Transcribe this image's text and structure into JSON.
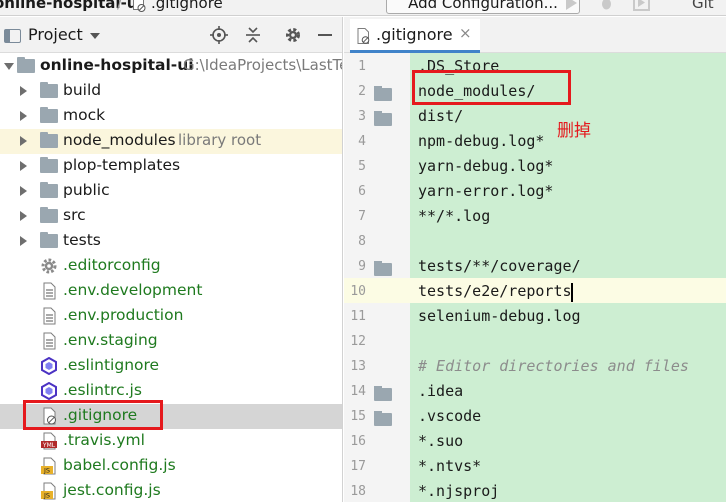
{
  "navbar": {
    "project_name": "online-hospital-ui",
    "separator": "/",
    "current_file": ".gitignore",
    "add_configuration": "Add Configuration...",
    "vcs_label": "Git"
  },
  "project_panel": {
    "title": "Project",
    "root": {
      "name": "online-hospital-ui",
      "path": "G:\\IdeaProjects\\LastTe"
    },
    "items": [
      {
        "label": "build",
        "kind": "folder"
      },
      {
        "label": "mock",
        "kind": "folder"
      },
      {
        "label": "node_modules",
        "kind": "folder",
        "hint": "library root"
      },
      {
        "label": "plop-templates",
        "kind": "folder"
      },
      {
        "label": "public",
        "kind": "folder"
      },
      {
        "label": "src",
        "kind": "folder"
      },
      {
        "label": "tests",
        "kind": "folder"
      },
      {
        "label": ".editorconfig",
        "kind": "config-file"
      },
      {
        "label": ".env.development",
        "kind": "text-file"
      },
      {
        "label": ".env.production",
        "kind": "text-file"
      },
      {
        "label": ".env.staging",
        "kind": "text-file"
      },
      {
        "label": ".eslintignore",
        "kind": "eslint-file"
      },
      {
        "label": ".eslintrc.js",
        "kind": "eslint-file"
      },
      {
        "label": ".gitignore",
        "kind": "gitignore-file",
        "selected": true
      },
      {
        "label": ".travis.yml",
        "kind": "yml-file"
      },
      {
        "label": "babel.config.js",
        "kind": "js-file"
      },
      {
        "label": "jest.config.js",
        "kind": "js-file"
      }
    ]
  },
  "editor": {
    "tab_label": ".gitignore",
    "tab_close": "×",
    "lines": [
      {
        "n": "1",
        "text": ".DS_Store"
      },
      {
        "n": "2",
        "text": "node_modules/"
      },
      {
        "n": "3",
        "text": "dist/"
      },
      {
        "n": "4",
        "text": "npm-debug.log*"
      },
      {
        "n": "5",
        "text": "yarn-debug.log*"
      },
      {
        "n": "6",
        "text": "yarn-error.log*"
      },
      {
        "n": "7",
        "text": "**/*.log"
      },
      {
        "n": "8",
        "text": ""
      },
      {
        "n": "9",
        "text": "tests/**/coverage/"
      },
      {
        "n": "10",
        "text": "tests/e2e/reports"
      },
      {
        "n": "11",
        "text": "selenium-debug.log"
      },
      {
        "n": "12",
        "text": ""
      },
      {
        "n": "13",
        "text": "# Editor directories and files"
      },
      {
        "n": "14",
        "text": ".idea"
      },
      {
        "n": "15",
        "text": ".vscode"
      },
      {
        "n": "16",
        "text": "*.suo"
      },
      {
        "n": "17",
        "text": "*.ntvs*"
      },
      {
        "n": "18",
        "text": "*.njsproj"
      }
    ]
  },
  "annotation": {
    "note": "删掉",
    "color": "#e5191d"
  },
  "colors": {
    "code_background": "#cdeed2",
    "library_root_background": "#fbf6dd",
    "selected_row": "#d5d5d5",
    "tab_underline": "#4083c9"
  },
  "icons": [
    "project-icon",
    "locate-icon",
    "collapse-icon",
    "settings-icon",
    "hide-icon",
    "folder-icon",
    "gear-icon",
    "text-file-icon",
    "eslint-icon",
    "gitignore-icon",
    "yml-icon",
    "js-file-icon",
    "run-icon",
    "debug-icon",
    "coverage-icon"
  ]
}
